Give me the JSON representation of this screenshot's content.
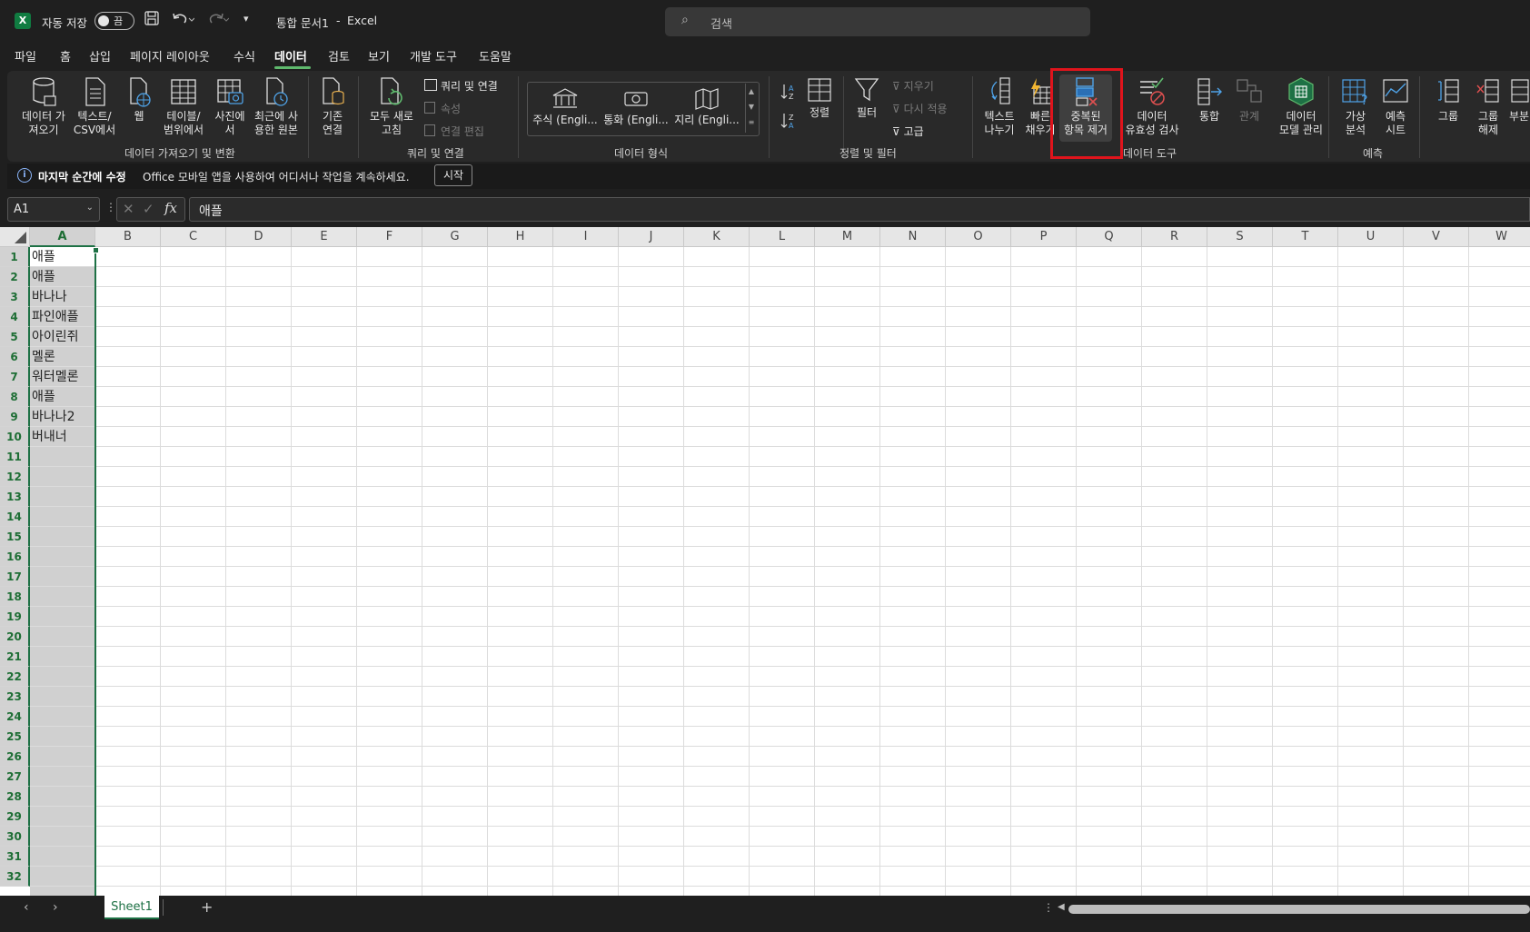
{
  "titlebar": {
    "autosave_label": "자동 저장",
    "autosave_state": "끔",
    "doc_title": "통합 문서1",
    "separator": "-",
    "app_name": "Excel",
    "search_placeholder": "검색"
  },
  "menu": {
    "tabs": [
      "파일",
      "홈",
      "삽입",
      "페이지 레이아웃",
      "수식",
      "데이터",
      "검토",
      "보기",
      "개발 도구",
      "도움말"
    ],
    "active": "데이터"
  },
  "ribbon": {
    "get_data": "데이터 가\n져오기",
    "text_csv": "텍스트/\nCSV에서",
    "web": "웹",
    "table_range": "테이블/\n범위에서",
    "from_picture": "사진에\n서",
    "recent_sources": "최근에 사\n용한 원본",
    "existing_conn": "기존\n연결",
    "refresh_all": "모두 새로\n고침",
    "queries_conn": "쿼리 및 연결",
    "properties": "속성",
    "edit_links": "연결 편집",
    "stocks": "주식 (Engli...",
    "currencies": "통화 (Engli...",
    "geography": "지리 (Engli...",
    "sort": "정렬",
    "filter": "필터",
    "clear": "지우기",
    "reapply": "다시 적용",
    "advanced": "고급",
    "text_to_columns": "텍스트\n나누기",
    "flash_fill": "빠른\n채우기",
    "remove_duplicates": "중복된\n항목 제거",
    "data_validation": "데이터\n유효성 검사",
    "consolidate": "통합",
    "relationships": "관계",
    "data_model": "데이터\n모델 관리",
    "whatif": "가상\n분석",
    "forecast_sheet": "예측\n시트",
    "group": "그룹",
    "ungroup": "그룹\n해제",
    "subtotal": "부분",
    "groups": {
      "get_transform": "데이터 가져오기 및 변환",
      "queries": "쿼리 및 연결",
      "data_types": "데이터 형식",
      "sort_filter": "정렬 및 필터",
      "data_tools": "데이터 도구",
      "forecast": "예측"
    }
  },
  "message_bar": {
    "title": "마지막 순간에 수정",
    "text": "Office 모바일 앱을 사용하여 어디서나 작업을 계속하세요.",
    "button": "시작"
  },
  "formula_bar": {
    "name_box": "A1",
    "formula": "애플"
  },
  "grid": {
    "columns": [
      "A",
      "B",
      "C",
      "D",
      "E",
      "F",
      "G",
      "H",
      "I",
      "J",
      "K",
      "L",
      "M",
      "N",
      "O",
      "P",
      "Q",
      "R",
      "S",
      "T",
      "U",
      "V",
      "W"
    ],
    "rows": [
      "1",
      "2",
      "3",
      "4",
      "5",
      "6",
      "7",
      "8",
      "9",
      "10",
      "11",
      "12",
      "13",
      "14",
      "15",
      "16",
      "17",
      "18",
      "19",
      "20",
      "21",
      "22",
      "23",
      "24",
      "25",
      "26",
      "27",
      "28",
      "29",
      "30",
      "31",
      "32"
    ],
    "selected_column": "A",
    "column_a_values": [
      "애플",
      "애플",
      "바나나",
      "파인애플",
      "아이린쥐",
      "멜론",
      "워터멜론",
      "애플",
      "바나나2",
      "버내너"
    ]
  },
  "sheets": {
    "tabs": [
      "Sheet1"
    ],
    "add": "+"
  },
  "colors": {
    "accent": "#1e7145",
    "highlight_box": "#e0141c",
    "ribbon_bg": "#292929",
    "titlebar_bg": "#1f1f1f"
  }
}
